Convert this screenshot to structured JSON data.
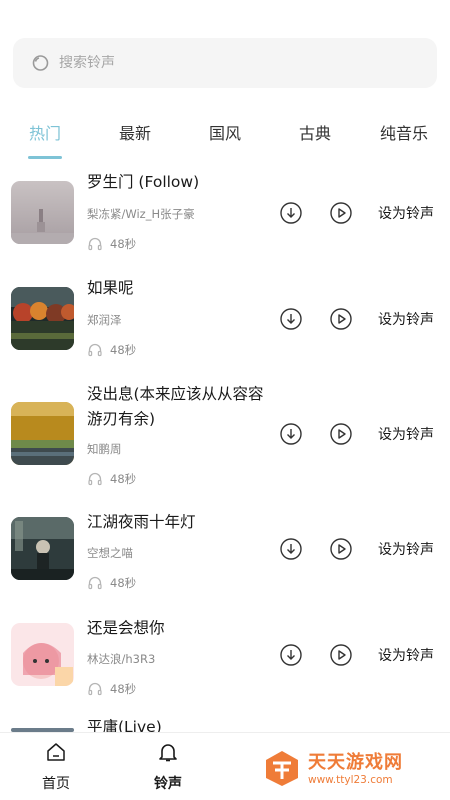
{
  "search": {
    "placeholder": "搜索铃声"
  },
  "tabs": [
    "热门",
    "最新",
    "国风",
    "古典",
    "纯音乐"
  ],
  "songs": [
    {
      "title": "罗生门 (Follow)",
      "artist": "梨冻紧/Wiz_H张子豪",
      "duration": "48秒",
      "action": "设为铃声"
    },
    {
      "title": "如果呢",
      "artist": "郑润泽",
      "duration": "48秒",
      "action": "设为铃声"
    },
    {
      "title": "没出息(本来应该从从容容游刃有余)",
      "artist": "知鹏周",
      "duration": "48秒",
      "action": "设为铃声"
    },
    {
      "title": "江湖夜雨十年灯",
      "artist": "空想之喵",
      "duration": "48秒",
      "action": "设为铃声"
    },
    {
      "title": "还是会想你",
      "artist": "林达浪/h3R3",
      "duration": "48秒",
      "action": "设为铃声"
    },
    {
      "title": "平庸(Live)"
    }
  ],
  "bottom_nav": {
    "home": "首页",
    "ringtone": "铃声"
  },
  "watermark": {
    "title": "天天游戏网",
    "url": "www.ttyl23.com"
  },
  "colors": {
    "accent": "#7ec3d6",
    "watermark": "#ef7c38"
  }
}
